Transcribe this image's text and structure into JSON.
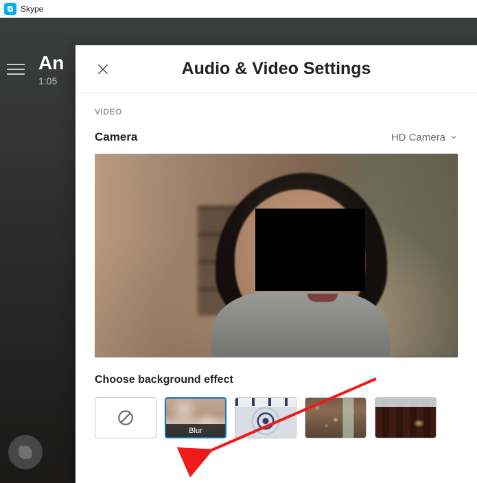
{
  "titlebar": {
    "appName": "Skype"
  },
  "background": {
    "callName": "An",
    "time": "1:05"
  },
  "panel": {
    "title": "Audio & Video Settings",
    "sectionLabel": "VIDEO",
    "cameraLabel": "Camera",
    "cameraSelected": "HD Camera",
    "effectLabel": "Choose background effect"
  },
  "effects": {
    "blurLabel": "Blur",
    "noneIcon": "none-icon",
    "selected": "blur"
  }
}
